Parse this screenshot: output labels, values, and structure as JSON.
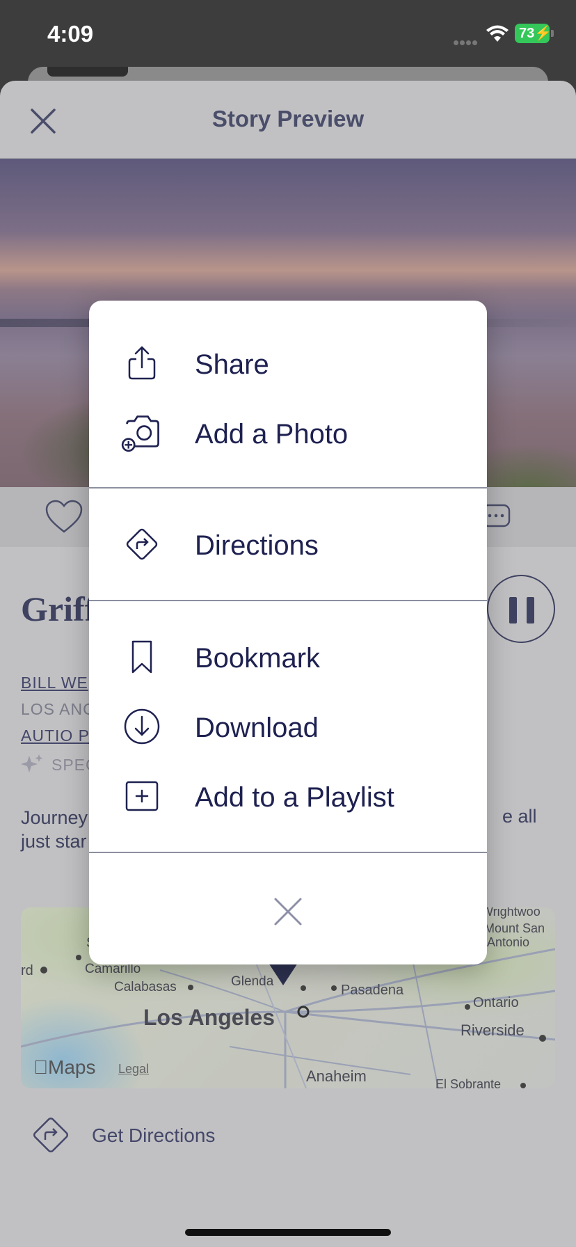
{
  "status_bar": {
    "time": "4:09",
    "battery": "73"
  },
  "sheet": {
    "title": "Story Preview"
  },
  "story": {
    "title_visible": "Griff",
    "author_visible": "BILL WE",
    "location_visible": "LOS ANC",
    "company_visible": "AUTIO P",
    "special_visible": "SPEC",
    "description_left_line1": "Journey",
    "description_left_line2": "just star",
    "description_right": "e all"
  },
  "map": {
    "labels": {
      "camarillo": "Camarillo",
      "calabasas": "Calabasas",
      "glendale": "Glenda",
      "pasadena": "Pasadena",
      "los_angeles": "Los Angeles",
      "ontario": "Ontario",
      "riverside": "Riverside",
      "anaheim": "Anaheim",
      "el_sobrante": "El Sobrante",
      "wrightwood": "Wrightwoo",
      "mount_san_antonio_1": "Mount San",
      "mount_san_antonio_2": "Antonio",
      "rd": "rd",
      "s": "S"
    },
    "maps_logo": "Maps",
    "legal": "Legal"
  },
  "directions": {
    "label": "Get Directions"
  },
  "menu": {
    "items": [
      {
        "label": "Share",
        "icon": "share-icon"
      },
      {
        "label": "Add a Photo",
        "icon": "add-photo-icon"
      },
      {
        "label": "Directions",
        "icon": "directions-icon"
      },
      {
        "label": "Bookmark",
        "icon": "bookmark-icon"
      },
      {
        "label": "Download",
        "icon": "download-icon"
      },
      {
        "label": "Add to a Playlist",
        "icon": "add-playlist-icon"
      }
    ],
    "close_icon": "close-icon"
  },
  "colors": {
    "primary_text": "#1e2150",
    "sheet_bg": "#c1c1c3",
    "battery_green": "#34c759"
  }
}
